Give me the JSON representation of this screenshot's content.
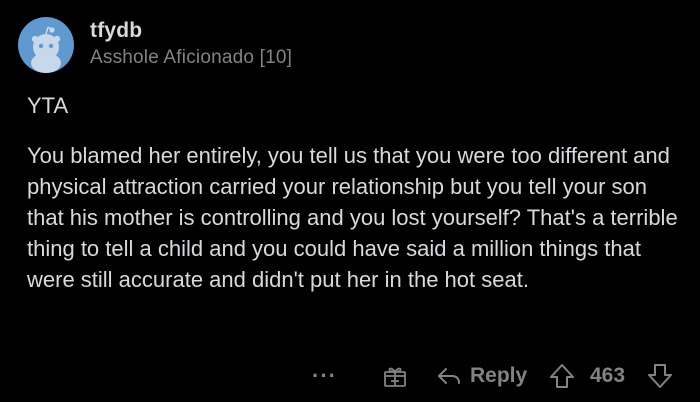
{
  "comment": {
    "author": "tfydb",
    "flair": "Asshole Aficionado [10]",
    "verdict": "YTA",
    "body": "You blamed her entirely, you tell us that you were too different and physical attraction carried your relationship but you tell your son that his mother is controlling and you lost yourself? That's a terrible thing to tell a child and you could have said a million things that were still accurate and didn't put her in the hot seat."
  },
  "actions": {
    "more_label": "···",
    "reply_label": "Reply",
    "score": "463"
  },
  "icons": {
    "avatar": "snoo-avatar-icon",
    "more": "more-options-icon",
    "award": "gift-award-icon",
    "reply": "reply-arrow-icon",
    "upvote": "upvote-arrow-icon",
    "downvote": "downvote-arrow-icon"
  },
  "colors": {
    "background": "#000000",
    "text": "#d7dadc",
    "muted": "#818384",
    "avatar_bg": "#5f99cf"
  }
}
